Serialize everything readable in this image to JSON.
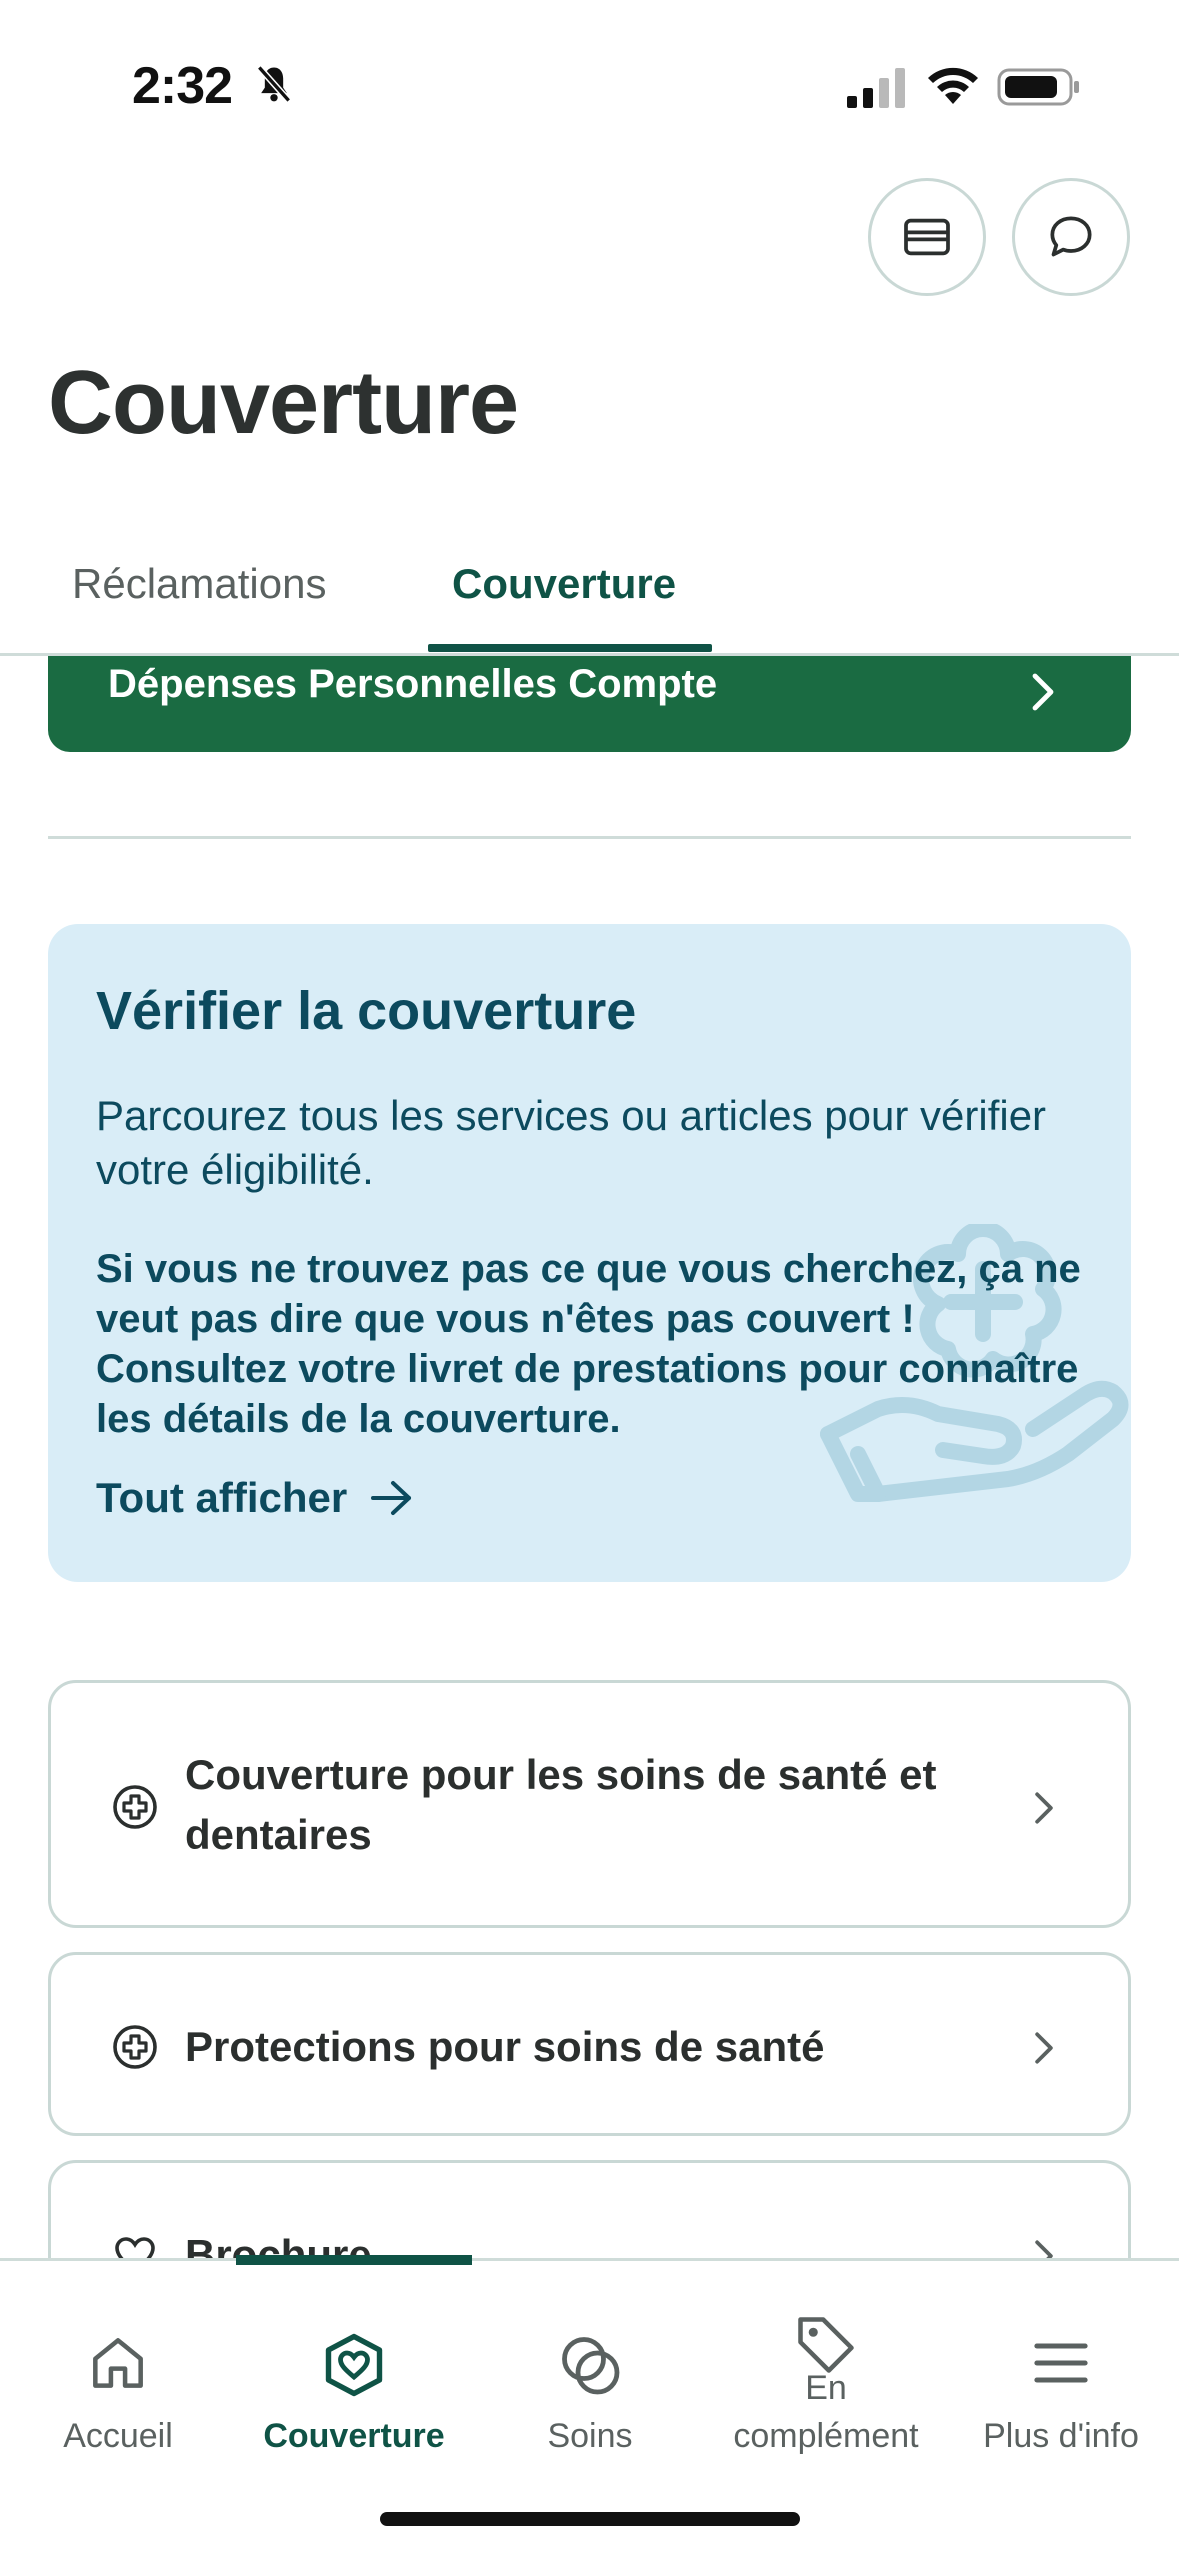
{
  "status_bar": {
    "time": "2:32"
  },
  "header": {
    "wallet_button": "wallet-icon",
    "chat_button": "chat-icon",
    "title": "Couverture"
  },
  "tabs": [
    {
      "label": "Réclamations",
      "active": false
    },
    {
      "label": "Couverture",
      "active": true
    }
  ],
  "green_card": {
    "label": "Dépenses Personnelles Compte"
  },
  "info_card": {
    "title": "Vérifier la couverture",
    "body": "Parcourez tous les services ou articles pour vérifier votre éligibilité.",
    "bold": "Si vous ne trouvez pas ce que vous cherchez, ça ne veut pas dire que vous n'êtes pas couvert ! Consultez votre livret de prestations pour connaître les détails de la couverture.",
    "link": "Tout afficher"
  },
  "list_items": [
    {
      "label": "Couverture pour les soins de santé et dentaires",
      "icon": "plus-circle-icon"
    },
    {
      "label": "Protections pour soins de santé",
      "icon": "plus-circle-icon"
    },
    {
      "label": "Brochure",
      "icon": "heart-icon"
    }
  ],
  "bottom_nav": [
    {
      "label": "Accueil",
      "icon": "home-icon",
      "active": false
    },
    {
      "label": "Couverture",
      "icon": "heart-shield-icon",
      "active": true
    },
    {
      "label": "Soins",
      "icon": "circles-icon",
      "active": false
    },
    {
      "label_line1": "En",
      "label_line2": "complément",
      "icon": "tag-icon",
      "active": false
    },
    {
      "label": "Plus d'info",
      "icon": "menu-icon",
      "active": false
    }
  ],
  "colors": {
    "brand_dark": "#0f5346",
    "green_card": "#1a6b42",
    "info_bg": "#d9edf7",
    "info_text": "#0c4a5e"
  }
}
